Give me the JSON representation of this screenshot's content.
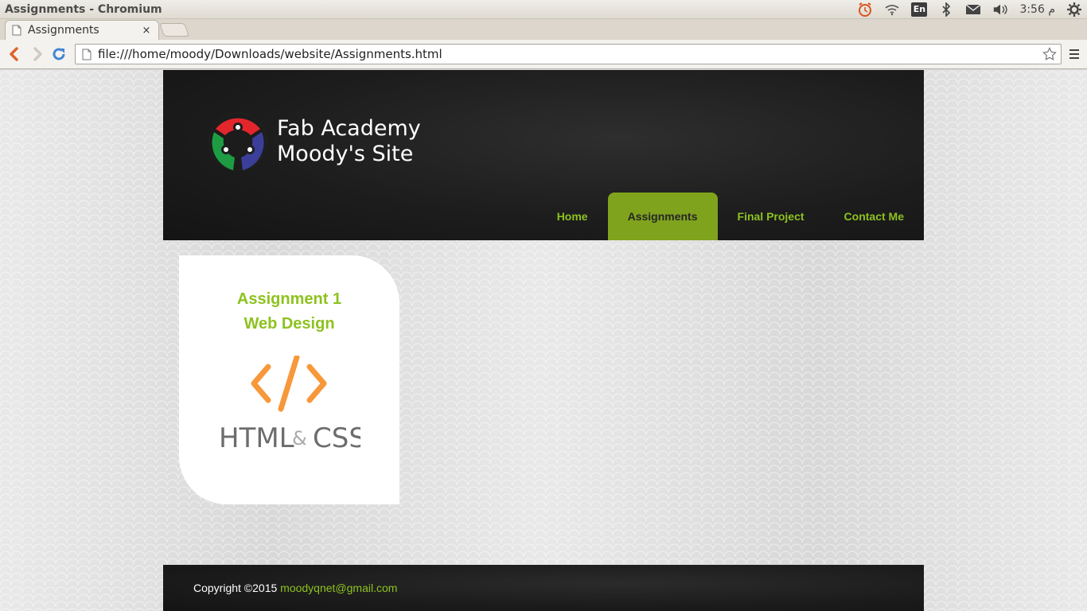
{
  "os_panel": {
    "window_title": "Assignments - Chromium",
    "keyboard_layout": "En",
    "time": "3:56 م"
  },
  "browser": {
    "tab_title": "Assignments",
    "tab_close_glyph": "×",
    "url": "file:///home/moody/Downloads/website/Assignments.html"
  },
  "site": {
    "title_line1": "Fab Academy",
    "title_line2": "Moody's Site",
    "nav": [
      {
        "label": "Home",
        "active": false
      },
      {
        "label": "Assignments",
        "active": true
      },
      {
        "label": "Final Project",
        "active": false
      },
      {
        "label": "Contact Me",
        "active": false
      }
    ],
    "card": {
      "title_line1": "Assignment 1",
      "title_line2": "Web Design",
      "art_text_left": "HTML",
      "art_text_amp": "&",
      "art_text_right": "CSS"
    },
    "footer": {
      "copyright": "Copyright ©2015 ",
      "email": "moodyqnet@gmail.com"
    }
  },
  "colors": {
    "accent_green": "#8dc21f",
    "active_tab_green": "#7fa31c",
    "html_css_orange": "#f7983a",
    "html_css_gray": "#6d6d6d",
    "header_dark": "#1d1d1d"
  },
  "icons": [
    "alarm-clock-icon",
    "wifi-icon",
    "bluetooth-icon",
    "mail-icon",
    "volume-icon",
    "settings-gear-icon",
    "page-icon",
    "back-arrow-icon",
    "forward-arrow-icon",
    "reload-icon",
    "bookmark-star-icon",
    "menu-icon",
    "fab-lab-logo"
  ]
}
